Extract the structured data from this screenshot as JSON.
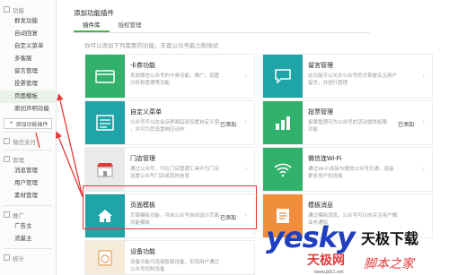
{
  "sidebar": {
    "groups": [
      {
        "title": "功能",
        "items": [
          "群发功能",
          "自动回复",
          "自定义菜单",
          "多客服",
          "留言管理",
          "投票管理",
          "页面模板",
          "原创声明功能"
        ]
      },
      {
        "title": "微信支付",
        "items": []
      },
      {
        "title": "管理",
        "items": [
          "消息管理",
          "用户管理",
          "素材管理"
        ]
      },
      {
        "title": "推广",
        "items": [
          "广告主",
          "流量主"
        ]
      },
      {
        "title": "统计",
        "items": []
      }
    ],
    "add_plugin_label": "添加功能插件"
  },
  "page_title": "添加功能插件",
  "tabs": [
    "插件库",
    "授权管理"
  ],
  "description": "你可以添加下列需要的功能，丰富公众号能力和体验",
  "cards": [
    {
      "title": "卡券功能",
      "desc1": "发放微信公众号的卡券功能，推广，设置",
      "desc2": "分析和管理等功能",
      "status": "",
      "icon": "card-icon",
      "color": "#32b16c"
    },
    {
      "title": "留言管理",
      "desc1": "此功能可以允许公众号的文章被关注用户",
      "desc2": "留言，并进行管理",
      "status": "",
      "icon": "message-icon",
      "color": "#1fa4a7"
    },
    {
      "title": "自定义菜单",
      "desc1": "公众号可以在会话界面底部设置自定义菜单",
      "desc2": "，并可为其设置响应动作",
      "status": "已添加",
      "icon": "menu-icon",
      "color": "#1fa4a7"
    },
    {
      "title": "投票管理",
      "desc1": "投票管理可为公众号的活动提供投票",
      "desc2": "功能",
      "status": "已添加",
      "icon": "chart-icon",
      "color": "#32b16c"
    },
    {
      "title": "门店管理",
      "desc1": "通过公众号，可在门店管理工具中为门店",
      "desc2": "设置公众号门店或其他信息",
      "status": "",
      "icon": "store-icon",
      "color": "#eaeaea"
    },
    {
      "title": "微信连Wi-Fi",
      "desc1": "通过Wi-Fi连接与微信公众号打通，连接",
      "desc2": "更多用户的连接",
      "status": "",
      "icon": "wifi-icon",
      "color": "#32b16c"
    },
    {
      "title": "页面模板",
      "desc1": "页面模板功能，可由公众号自由设计页面",
      "desc2": "功能模板",
      "status": "已添加",
      "icon": "home-icon",
      "color": "#1fa4a7"
    },
    {
      "title": "模板消息",
      "desc1": "通过模板消息，公众号可以向关注用户推送",
      "desc2": "业务通知",
      "status": "",
      "icon": "template-icon",
      "color": "#f18e3c"
    },
    {
      "title": "设备功能",
      "desc1": "设备功能可连接智能设备，实现用户通过",
      "desc2": "公众号控制设备",
      "status": "",
      "icon": "washer-icon",
      "color": "#f6ead8"
    }
  ],
  "watermark": {
    "yesky": "yesky",
    "tianji": "天极下载",
    "tianji2": "天极网",
    "jiaoben": "脚本之家",
    "url": "www.jb51.net"
  }
}
